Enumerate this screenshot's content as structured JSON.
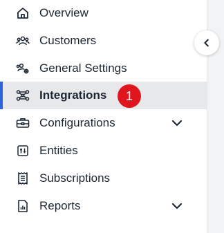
{
  "sidebar": {
    "items": [
      {
        "label": "Overview",
        "icon": "home-icon",
        "active": false,
        "expandable": false
      },
      {
        "label": "Customers",
        "icon": "users-icon",
        "active": false,
        "expandable": false
      },
      {
        "label": "General Settings",
        "icon": "users-gear-icon",
        "active": false,
        "expandable": false
      },
      {
        "label": "Integrations",
        "icon": "integrations-icon",
        "active": true,
        "expandable": false,
        "badge": "1"
      },
      {
        "label": "Configurations",
        "icon": "toolbox-icon",
        "active": false,
        "expandable": true
      },
      {
        "label": "Entities",
        "icon": "entities-icon",
        "active": false,
        "expandable": false
      },
      {
        "label": "Subscriptions",
        "icon": "receipt-icon",
        "active": false,
        "expandable": false
      },
      {
        "label": "Reports",
        "icon": "report-icon",
        "active": false,
        "expandable": true
      }
    ]
  },
  "colors": {
    "active_background": "#e7e8ea",
    "active_indicator": "#2a66d9",
    "badge": "#e0161e",
    "text": "#1c2733"
  },
  "collapse_button": {
    "icon": "chevron-left-icon"
  }
}
